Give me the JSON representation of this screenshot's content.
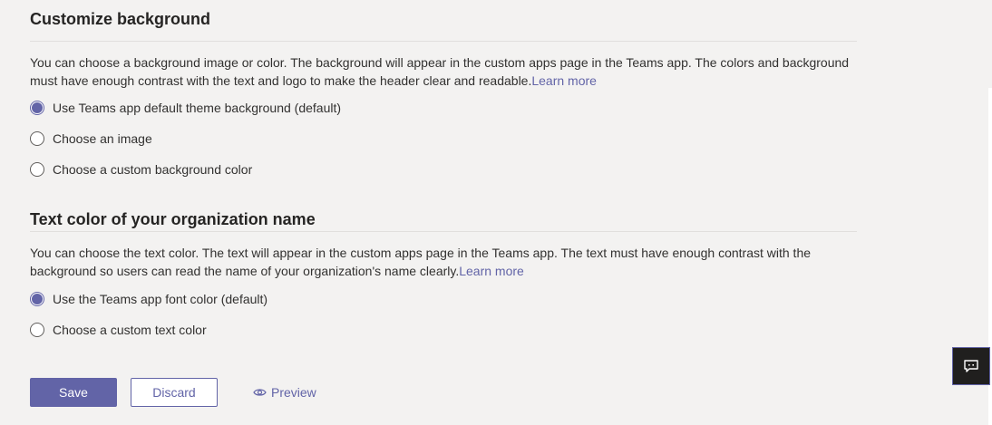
{
  "background_section": {
    "title": "Customize background",
    "description": "You can choose a background image or color. The background will appear in the custom apps page in the Teams app. The colors and background must have enough contrast with the text and logo to make the header clear and readable.",
    "learn_more": "Learn more",
    "options": [
      {
        "label": "Use Teams app default theme background (default)",
        "checked": true
      },
      {
        "label": "Choose an image",
        "checked": false
      },
      {
        "label": "Choose a custom background color",
        "checked": false
      }
    ]
  },
  "text_color_section": {
    "title": "Text color of your organization name",
    "description": "You can choose the text color. The text will appear in the custom apps page in the Teams app. The text must have enough contrast with the background so users can read the name of your organization's name clearly.",
    "learn_more": "Learn more",
    "options": [
      {
        "label": "Use the Teams app font color (default)",
        "checked": true
      },
      {
        "label": "Choose a custom text color",
        "checked": false
      }
    ]
  },
  "actions": {
    "save": "Save",
    "discard": "Discard",
    "preview": "Preview"
  },
  "colors": {
    "accent": "#6264a7",
    "background": "#f3f2f1",
    "feedback_bg": "#201f1e"
  },
  "icons": {
    "preview": "eye-icon",
    "feedback": "feedback-icon"
  }
}
